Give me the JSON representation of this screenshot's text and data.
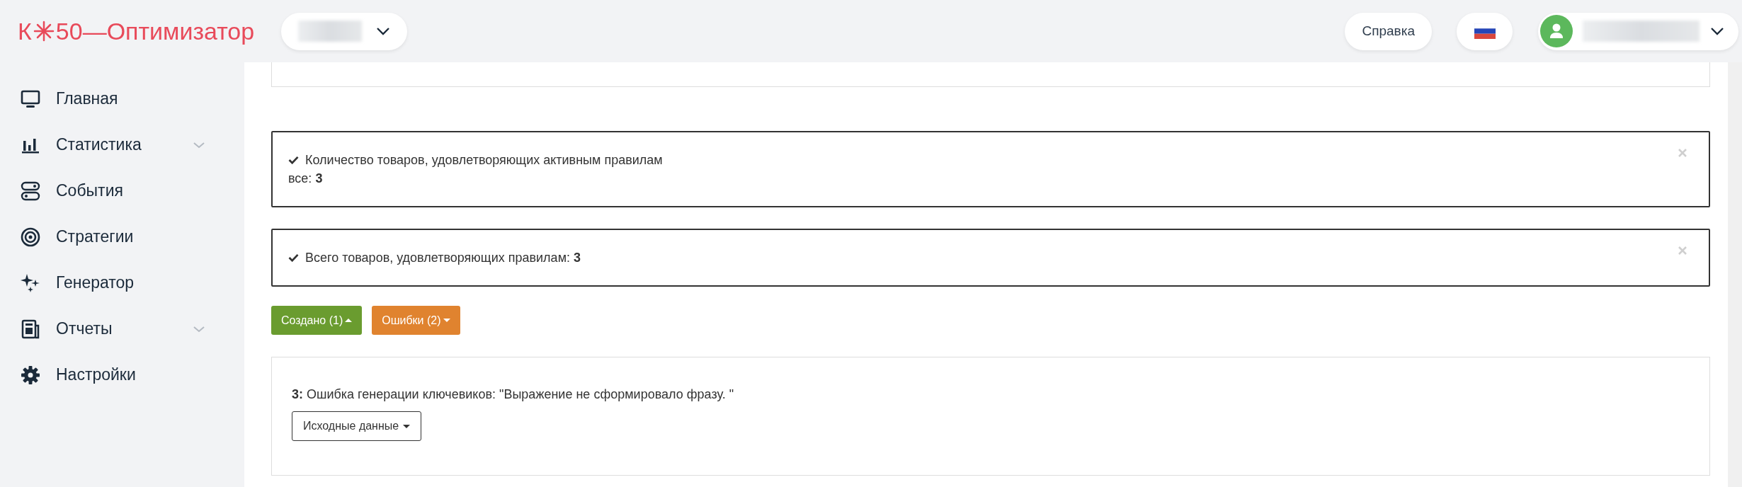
{
  "header": {
    "logo_prefix": "К",
    "logo_suffix": "50—Оптимизатор",
    "help_button": "Справка"
  },
  "sidebar": {
    "items": [
      {
        "label": "Главная",
        "has_submenu": false
      },
      {
        "label": "Статистика",
        "has_submenu": true
      },
      {
        "label": "События",
        "has_submenu": false
      },
      {
        "label": "Стратегии",
        "has_submenu": false
      },
      {
        "label": "Генератор",
        "has_submenu": false
      },
      {
        "label": "Отчеты",
        "has_submenu": true
      },
      {
        "label": "Настройки",
        "has_submenu": false
      }
    ]
  },
  "alerts": [
    {
      "text": "Количество товаров, удовлетворяющих активным правилам",
      "detail": "все: **3**"
    },
    {
      "text": "Всего товаров, удовлетворяющих правилам: **3**"
    }
  ],
  "result_buttons": [
    {
      "label": "Создано (1)",
      "color": "#6a9c2f",
      "expanded": true
    },
    {
      "label": "Ошибки (2)",
      "color": "#e0832f",
      "expanded": false
    }
  ],
  "errors": [
    {
      "text": "**3:** Ошибка генерации ключевиков: \"Выражение не сформировало фразу. \"",
      "button": "Исходные данные"
    }
  ]
}
